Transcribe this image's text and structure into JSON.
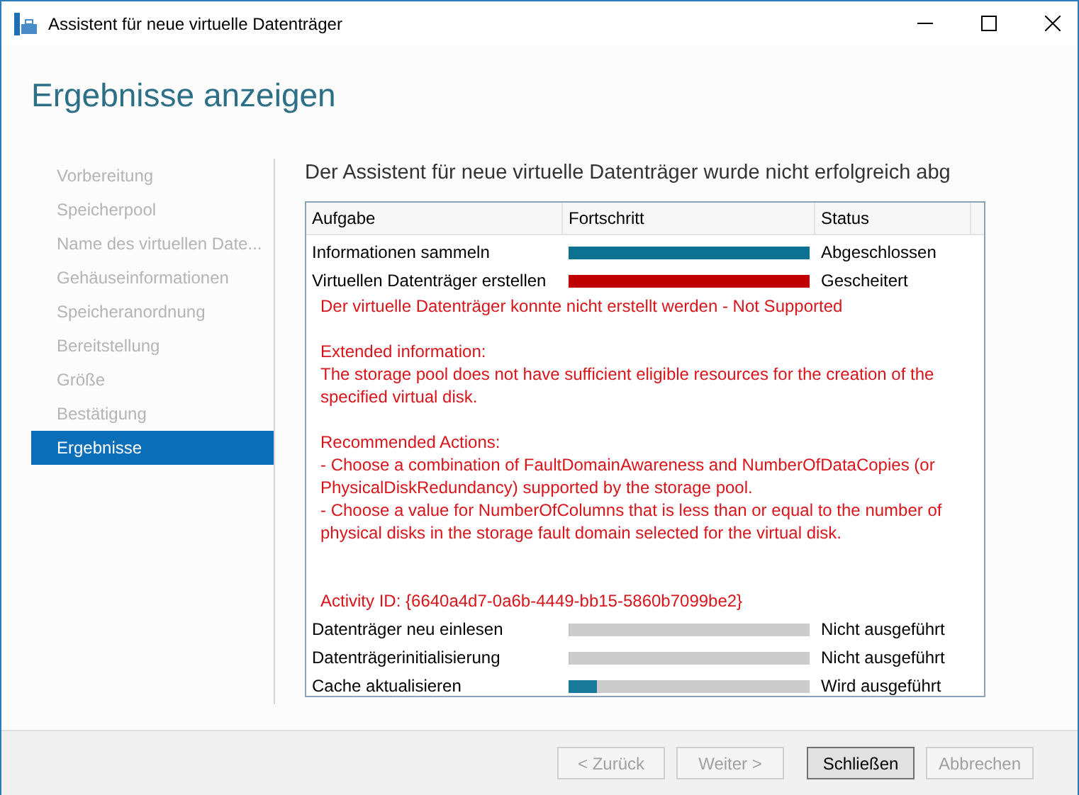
{
  "window": {
    "title": "Assistent für neue virtuelle Datenträger"
  },
  "page_title": "Ergebnisse anzeigen",
  "sidebar": {
    "items": [
      {
        "label": "Vorbereitung",
        "selected": false
      },
      {
        "label": "Speicherpool",
        "selected": false
      },
      {
        "label": "Name des virtuellen Date...",
        "selected": false
      },
      {
        "label": "Gehäuseinformationen",
        "selected": false
      },
      {
        "label": "Speicheranordnung",
        "selected": false
      },
      {
        "label": "Bereitstellung",
        "selected": false
      },
      {
        "label": "Größe",
        "selected": false
      },
      {
        "label": "Bestätigung",
        "selected": false
      },
      {
        "label": "Ergebnisse",
        "selected": true
      }
    ]
  },
  "summary": "Der Assistent für neue virtuelle Datenträger wurde nicht erfolgreich abg",
  "table": {
    "columns": [
      "Aufgabe",
      "Fortschritt",
      "Status"
    ],
    "rows": [
      {
        "task": "Informationen sammeln",
        "color": "#0b7391",
        "level": 1,
        "status": "Abgeschlossen"
      },
      {
        "task": "Virtuellen Datenträger erstellen",
        "color": "#c00000",
        "level": 1,
        "status": "Gescheitert",
        "error": [
          [
            "Der virtuelle Datenträger konnte nicht erstellt werden - Not Supported"
          ],
          [
            "Extended information:",
            "The storage pool does not have sufficient eligible resources for the creation of the",
            "specified virtual disk."
          ],
          [
            "Recommended Actions:",
            "- Choose a combination of FaultDomainAwareness and NumberOfDataCopies (or",
            "PhysicalDiskRedundancy) supported by the storage pool.",
            "- Choose a value for NumberOfColumns that is less than or equal to the number of",
            "physical disks in the storage fault domain selected for the virtual disk."
          ],
          [
            "Activity ID: {6640a4d7-0a6b-4449-bb15-5860b7099be2}"
          ]
        ]
      },
      {
        "task": "Datenträger neu einlesen",
        "level": 0,
        "status": "Nicht ausgeführt"
      },
      {
        "task": "Datenträgerinitialisierung",
        "level": 0,
        "status": "Nicht ausgeführt"
      },
      {
        "task": "Cache aktualisieren",
        "color": "#1a7a9a",
        "level": 0.12,
        "status": "Wird ausgeführt"
      }
    ]
  },
  "buttons": [
    {
      "label": "< Zurück",
      "disabled": true,
      "default": false
    },
    {
      "label": "Weiter >",
      "disabled": true,
      "default": false
    },
    {
      "label": "Schließen",
      "disabled": false,
      "default": true
    },
    {
      "label": "Abbrechen",
      "disabled": true,
      "default": false
    }
  ]
}
